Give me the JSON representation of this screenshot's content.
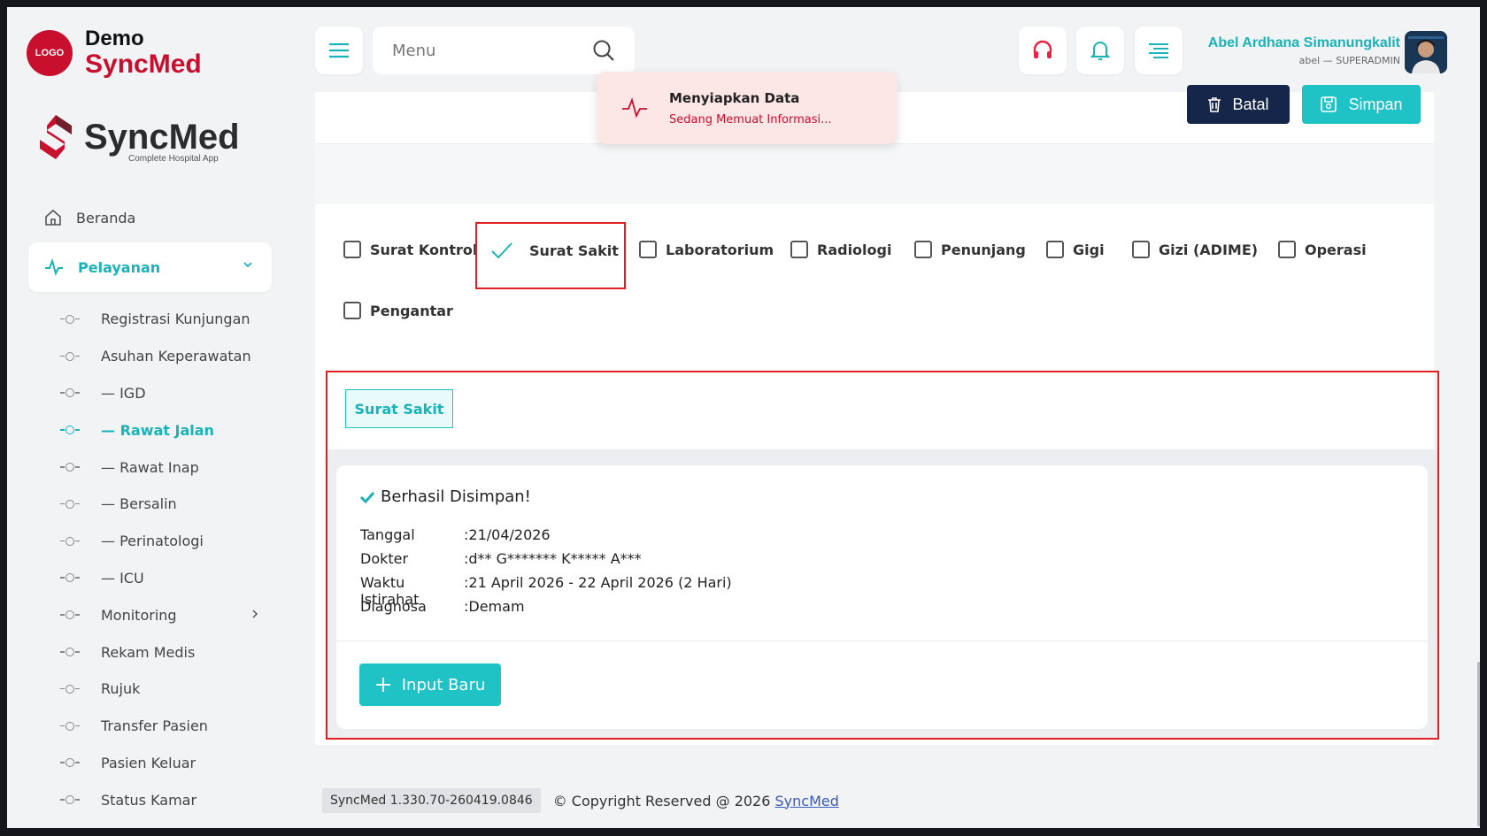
{
  "brand": {
    "logo_badge": "LOGO",
    "demo": "Demo",
    "name": "SyncMed",
    "big_name": "SyncMed",
    "tagline": "Complete Hospital App"
  },
  "sidebar": {
    "home": "Beranda",
    "section": "Pelayanan",
    "items": [
      {
        "label": "Registrasi Kunjungan"
      },
      {
        "label": "Asuhan Keperawatan"
      },
      {
        "label": "— IGD"
      },
      {
        "label": "— Rawat Jalan"
      },
      {
        "label": "— Rawat Inap"
      },
      {
        "label": "— Bersalin"
      },
      {
        "label": "— Perinatologi"
      },
      {
        "label": "— ICU"
      },
      {
        "label": "Monitoring"
      },
      {
        "label": "Rekam Medis"
      },
      {
        "label": "Rujuk"
      },
      {
        "label": "Transfer Pasien"
      },
      {
        "label": "Pasien Keluar"
      },
      {
        "label": "Status Kamar"
      }
    ]
  },
  "header": {
    "search_placeholder": "Menu",
    "user_name": "Abel Ardhana Simanungkalit",
    "user_role": "abel — SUPERADMIN"
  },
  "toast": {
    "title": "Menyiapkan Data",
    "message": "Sedang Memuat Informasi..."
  },
  "toolbar": {
    "cancel_label": "Batal",
    "save_label": "Simpan"
  },
  "checkboxes": [
    {
      "label": "Surat Kontrol",
      "checked": false
    },
    {
      "label": "Surat Sakit",
      "checked": true
    },
    {
      "label": "Laboratorium",
      "checked": false
    },
    {
      "label": "Radiologi",
      "checked": false
    },
    {
      "label": "Penunjang",
      "checked": false
    },
    {
      "label": "Gigi",
      "checked": false
    },
    {
      "label": "Gizi (ADIME)",
      "checked": false
    },
    {
      "label": "Operasi",
      "checked": false
    },
    {
      "label": "Pengantar",
      "checked": false
    }
  ],
  "letter": {
    "tab_label": "Surat Sakit",
    "success_title": "Berhasil Disimpan!",
    "rows": [
      {
        "label": "Tanggal",
        "value": "21/04/2026"
      },
      {
        "label": "Dokter",
        "value": "d** G******* K***** A***"
      },
      {
        "label": "Waktu Istirahat",
        "value": "21 April 2026 - 22 April 2026 (2 Hari)"
      },
      {
        "label": "Diagnosa",
        "value": "Demam"
      }
    ],
    "new_button": "Input Baru"
  },
  "footer": {
    "version": "SyncMed 1.330.70-260419.0846",
    "copyright": "© Copyright Reserved @ 2026",
    "link": "SyncMed"
  },
  "colors": {
    "accent": "#1fc2c5",
    "brand_red": "#c8102e",
    "navy": "#16264a"
  }
}
